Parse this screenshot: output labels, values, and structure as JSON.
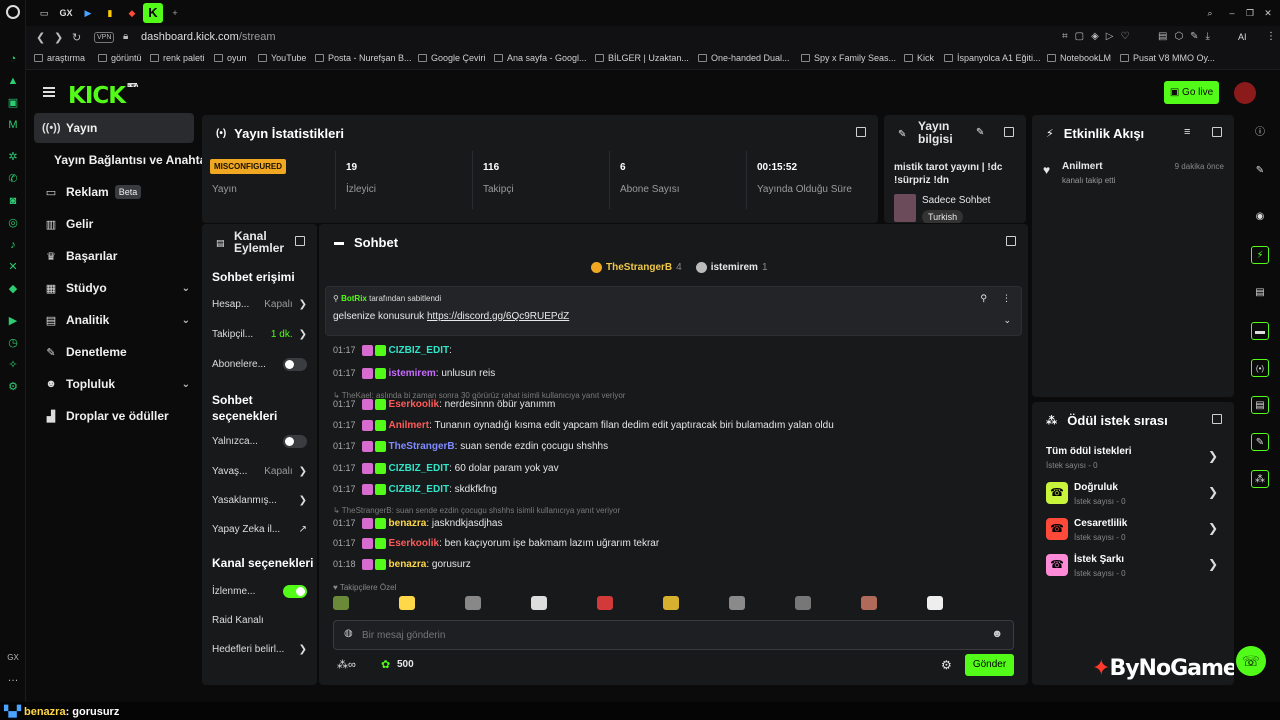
{
  "browser": {
    "tabs": [
      "GX"
    ],
    "url_domain": "dashboard.kick.com",
    "url_path": "/stream",
    "vpn": "VPN",
    "bookmarks": [
      "araştırma",
      "görüntü",
      "renk paleti",
      "oyun",
      "YouTube",
      "Posta - Nurefşan B...",
      "Google Çeviri",
      "Ana sayfa - Googl...",
      "BİLGER | Uzaktan...",
      "One-handed Dual...",
      "Spy x Family Seas...",
      "Kick",
      "İspanyolca A1 Eğiti...",
      "NotebookLM",
      "Pusat V8 MMO Oy..."
    ],
    "ai": "AI"
  },
  "header": {
    "logo": "KICK",
    "logo_tag": "BETA",
    "go_live": "Go live"
  },
  "sidebar": {
    "items": [
      {
        "label": "Yayın",
        "icon": "broadcast-icon"
      },
      {
        "label": "Yayın Bağlantısı ve Anahtarı"
      },
      {
        "label": "Reklam",
        "beta": "Beta",
        "icon": "ad-icon"
      },
      {
        "label": "Gelir",
        "icon": "revenue-icon"
      },
      {
        "label": "Başarılar",
        "icon": "trophy-icon"
      },
      {
        "label": "Stüdyo",
        "icon": "studio-icon"
      },
      {
        "label": "Analitik",
        "icon": "analytics-icon"
      },
      {
        "label": "Denetleme",
        "icon": "wrench-icon"
      },
      {
        "label": "Topluluk",
        "icon": "community-icon"
      },
      {
        "label": "Droplar ve ödüller",
        "icon": "drops-icon"
      }
    ]
  },
  "stats": {
    "title": "Yayın İstatistikleri",
    "status_badge": "MISCONFIGURED",
    "status_label": "Yayın",
    "cells": [
      {
        "value": "19",
        "label": "İzleyici"
      },
      {
        "value": "116",
        "label": "Takipçi"
      },
      {
        "value": "6",
        "label": "Abone Sayısı"
      },
      {
        "value": "00:15:52",
        "label": "Yayında Olduğu Süre"
      }
    ]
  },
  "info": {
    "title": "Yayın bilgisi",
    "stream_title": "mistik tarot yayını | !dc !sürpriz !dn",
    "category": "Sadece Sohbet",
    "tag": "Turkish"
  },
  "activity": {
    "title": "Etkinlik Akışı",
    "user": "Anilmert",
    "time": "9 dakika önce",
    "desc": "kanalı takip etti"
  },
  "channel": {
    "title_1": "Kanal",
    "title_2": "Eylemler",
    "sec1": "Sohbet erişimi",
    "r1": "Hesap...",
    "r1v": "Kapalı",
    "r2": "Takipçil...",
    "r2v": "1 dk.",
    "r3": "Abonelere...",
    "sec2": "Sohbet",
    "sec2b": "seçenekleri",
    "r4": "Yalnızca...",
    "r5": "Yavaş...",
    "r5v": "Kapalı",
    "r6": "Yasaklanmış...",
    "r7": "Yapay Zeka il...",
    "sec3": "Kanal seçenekleri",
    "r8": "İzlenme...",
    "r9": "Raid Kanalı",
    "r10": "Hedefleri belirl..."
  },
  "chat": {
    "title": "Sohbet",
    "top_users": [
      {
        "name": "TheStrangerB",
        "count": "4"
      },
      {
        "name": "istemirem",
        "count": "1"
      }
    ],
    "pinned_by": "BotRix",
    "pinned_suffix": "tarafından sabitlendi",
    "pinned_text": "gelsenize konusuruk",
    "pinned_link": "https://discord.gg/6Qc9RUEPdZ",
    "messages": [
      {
        "time": "01:17",
        "user": "CIZBIZ_EDIT",
        "text": "",
        "color": "#2ee6c8"
      },
      {
        "time": "01:17",
        "user": "istemirem",
        "text": "unlusun reis",
        "color": "#c86bff"
      },
      {
        "reply": "TheKael: aslında bi zaman sonra 30 görürüz rahat isimli kullanıcıya yanıt veriyor"
      },
      {
        "time": "01:17",
        "user": "Eserkoolik",
        "text": "nerdesinnn öbür yanımm",
        "color": "#ff5a5a"
      },
      {
        "time": "01:17",
        "user": "Anilmert",
        "text": "Tunanın oynadığı kısma edit yapcam filan dedim edit yaptıracak biri bulamadım yalan oldu",
        "color": "#ff5a5a"
      },
      {
        "time": "01:17",
        "user": "TheStrangerB",
        "text": "suan sende ezdin çocugu shshhs",
        "color": "#7f8cff"
      },
      {
        "time": "01:17",
        "user": "CIZBIZ_EDIT",
        "text": "60 dolar param yok yav",
        "color": "#2ee6c8"
      },
      {
        "time": "01:17",
        "user": "CIZBIZ_EDIT",
        "text": "skdkfkfng",
        "color": "#2ee6c8"
      },
      {
        "reply": "TheStrangerB: suan sende ezdin çocugu shshhs isimli kullanıcıya yanıt veriyor"
      },
      {
        "time": "01:17",
        "user": "benazra",
        "text": "jaskndkjasdjhas",
        "color": "#ffd84a"
      },
      {
        "time": "01:17",
        "user": "Eserkoolik",
        "text": "ben kaçıyorum işe bakmam lazım uğrarım tekrar",
        "color": "#ff5a5a"
      },
      {
        "time": "01:18",
        "user": "benazra",
        "text": "gorusurz",
        "color": "#ffd84a"
      }
    ],
    "followers_only": "Takipçilere Özel",
    "placeholder": "Bir mesaj gönderin",
    "points": "500",
    "send": "Gönder"
  },
  "rewards": {
    "title": "Ödül istek sırası",
    "all": "Tüm ödül istekleri",
    "all_sub": "İstek sayısı - 0",
    "items": [
      {
        "name": "Doğruluk",
        "sub": "İstek sayısı - 0",
        "color": "#c8f43c"
      },
      {
        "name": "Cesaretlilik",
        "sub": "İstek sayısı - 0",
        "color": "#ff4a3a"
      },
      {
        "name": "İstek Şarkı",
        "sub": "İstek sayısı - 0",
        "color": "#ff8ad8"
      }
    ]
  },
  "watermark": "ByNoGame",
  "ticker": {
    "user": "benazra",
    "text": ": gorusurz"
  }
}
